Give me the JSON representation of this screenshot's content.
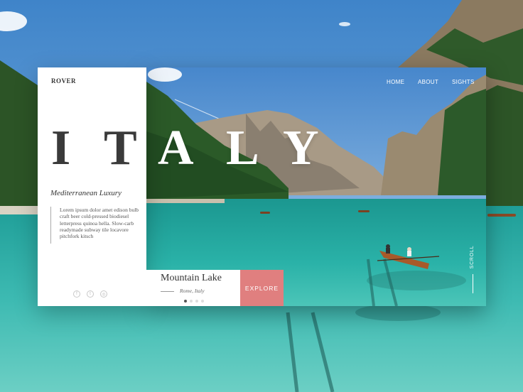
{
  "brand": "ROVER",
  "title_letters": [
    "I",
    "T",
    "A",
    "L",
    "Y"
  ],
  "nav": {
    "items": [
      "HOME",
      "ABOUT",
      "SIGHTS"
    ]
  },
  "panel": {
    "tagline": "Mediterranean Luxury",
    "blurb": "Lorem ipsum dolor amet edison bulb craft beer cold-pressed biodiesel letterpress quinoa hella. Slow-carb readymade subway tile locavore pitchfork kitsch",
    "socials": [
      "facebook-icon",
      "twitter-icon",
      "instagram-icon"
    ]
  },
  "info": {
    "title": "Mountain Lake",
    "subtitle": "Rome, Italy",
    "slides": 4,
    "active_slide": 1
  },
  "explore_label": "EXPLORE",
  "scroll_label": "SCROLL",
  "colors": {
    "accent": "#e07f7f",
    "lake": "#2aa69f",
    "sky": "#4a8fd0"
  }
}
